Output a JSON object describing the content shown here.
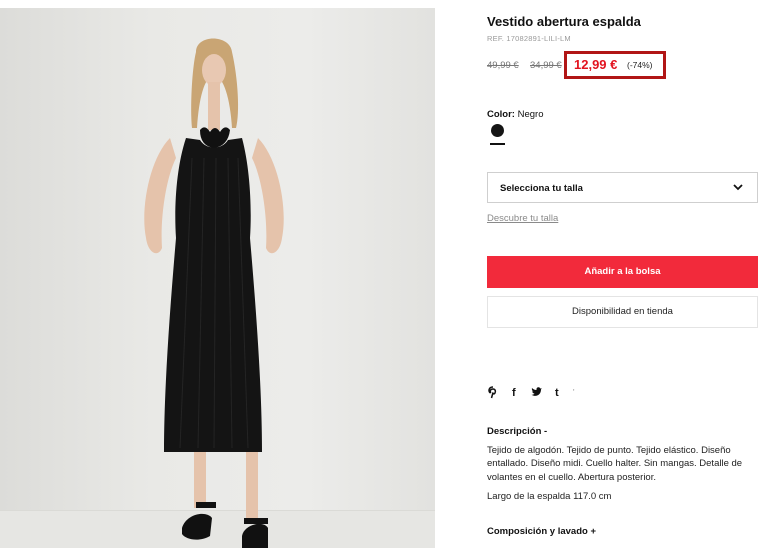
{
  "product": {
    "title": "Vestido abertura espalda",
    "ref": "REF. 17082891-LILI-LM",
    "price_original": "49,99 €",
    "price_previous": "34,99 €",
    "price_current": "12,99 €",
    "discount": "(-74%)"
  },
  "color": {
    "label": "Color:",
    "value": "Negro",
    "swatches": [
      {
        "name": "Negro",
        "hex": "#151515",
        "selected": true
      }
    ]
  },
  "size": {
    "select_label": "Selecciona tu talla",
    "guide_link": "Descubre tu talla"
  },
  "actions": {
    "add_to_bag": "Añadir a la bolsa",
    "store_availability": "Disponibilidad en tienda"
  },
  "share": {
    "icons": [
      "pinterest-icon",
      "facebook-icon",
      "twitter-icon",
      "tumblr-icon"
    ],
    "glyphs": [
      "℗",
      "f",
      "🐦",
      "t"
    ]
  },
  "description": {
    "heading": "Descripción -",
    "text": "Tejido de algodón. Tejido de punto. Tejido elástico. Diseño entallado. Diseño midi. Cuello halter. Sin mangas. Detalle de volantes en el cuello. Abertura posterior.",
    "length": "Largo de la espalda 117.0 cm"
  },
  "composition": {
    "heading": "Composición y lavado +"
  },
  "colors": {
    "accent_red": "#f22a3b",
    "price_red": "#e2131f",
    "highlight_border": "#b11616"
  }
}
